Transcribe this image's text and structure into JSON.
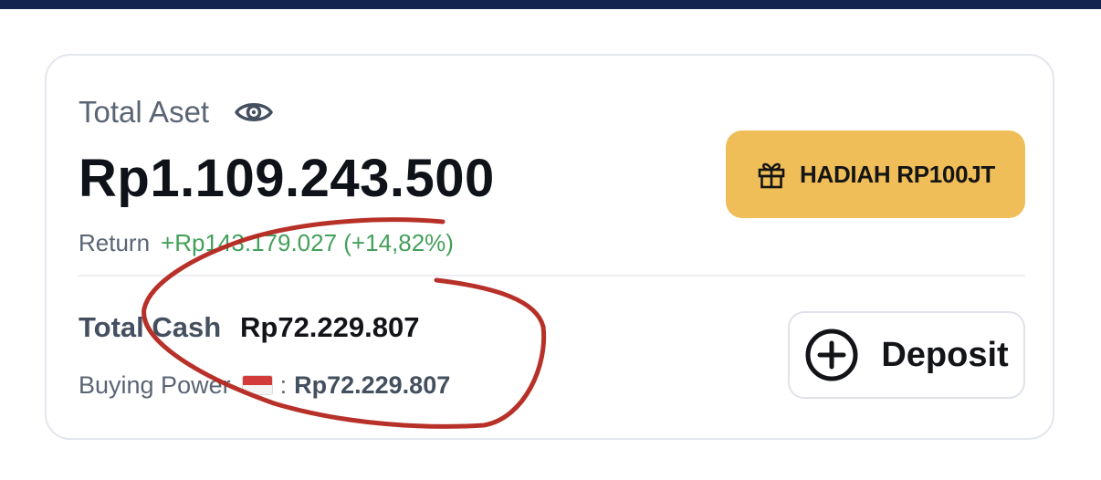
{
  "header": {
    "bar_color": "#13244f"
  },
  "portfolio": {
    "total_label": "Total Aset",
    "visibility_icon": "eye-icon",
    "total_value": "Rp1.109.243.500",
    "return_label": "Return",
    "return_value": "+Rp143.179.027 (+14,82%)",
    "return_color": "#43a05a"
  },
  "promo": {
    "icon": "gift-icon",
    "label": "HADIAH RP100JT",
    "color": "#f0be58"
  },
  "cash": {
    "label": "Total Cash",
    "value": "Rp72.229.807",
    "buying_power_label": "Buying Power",
    "flag_icon": "indonesia-flag-icon",
    "separator": ":",
    "buying_power_value": "Rp72.229.807"
  },
  "deposit": {
    "icon": "plus-circle-icon",
    "label": "Deposit"
  },
  "annotation": {
    "shape": "hand-drawn-circle",
    "color": "#b3261e"
  }
}
